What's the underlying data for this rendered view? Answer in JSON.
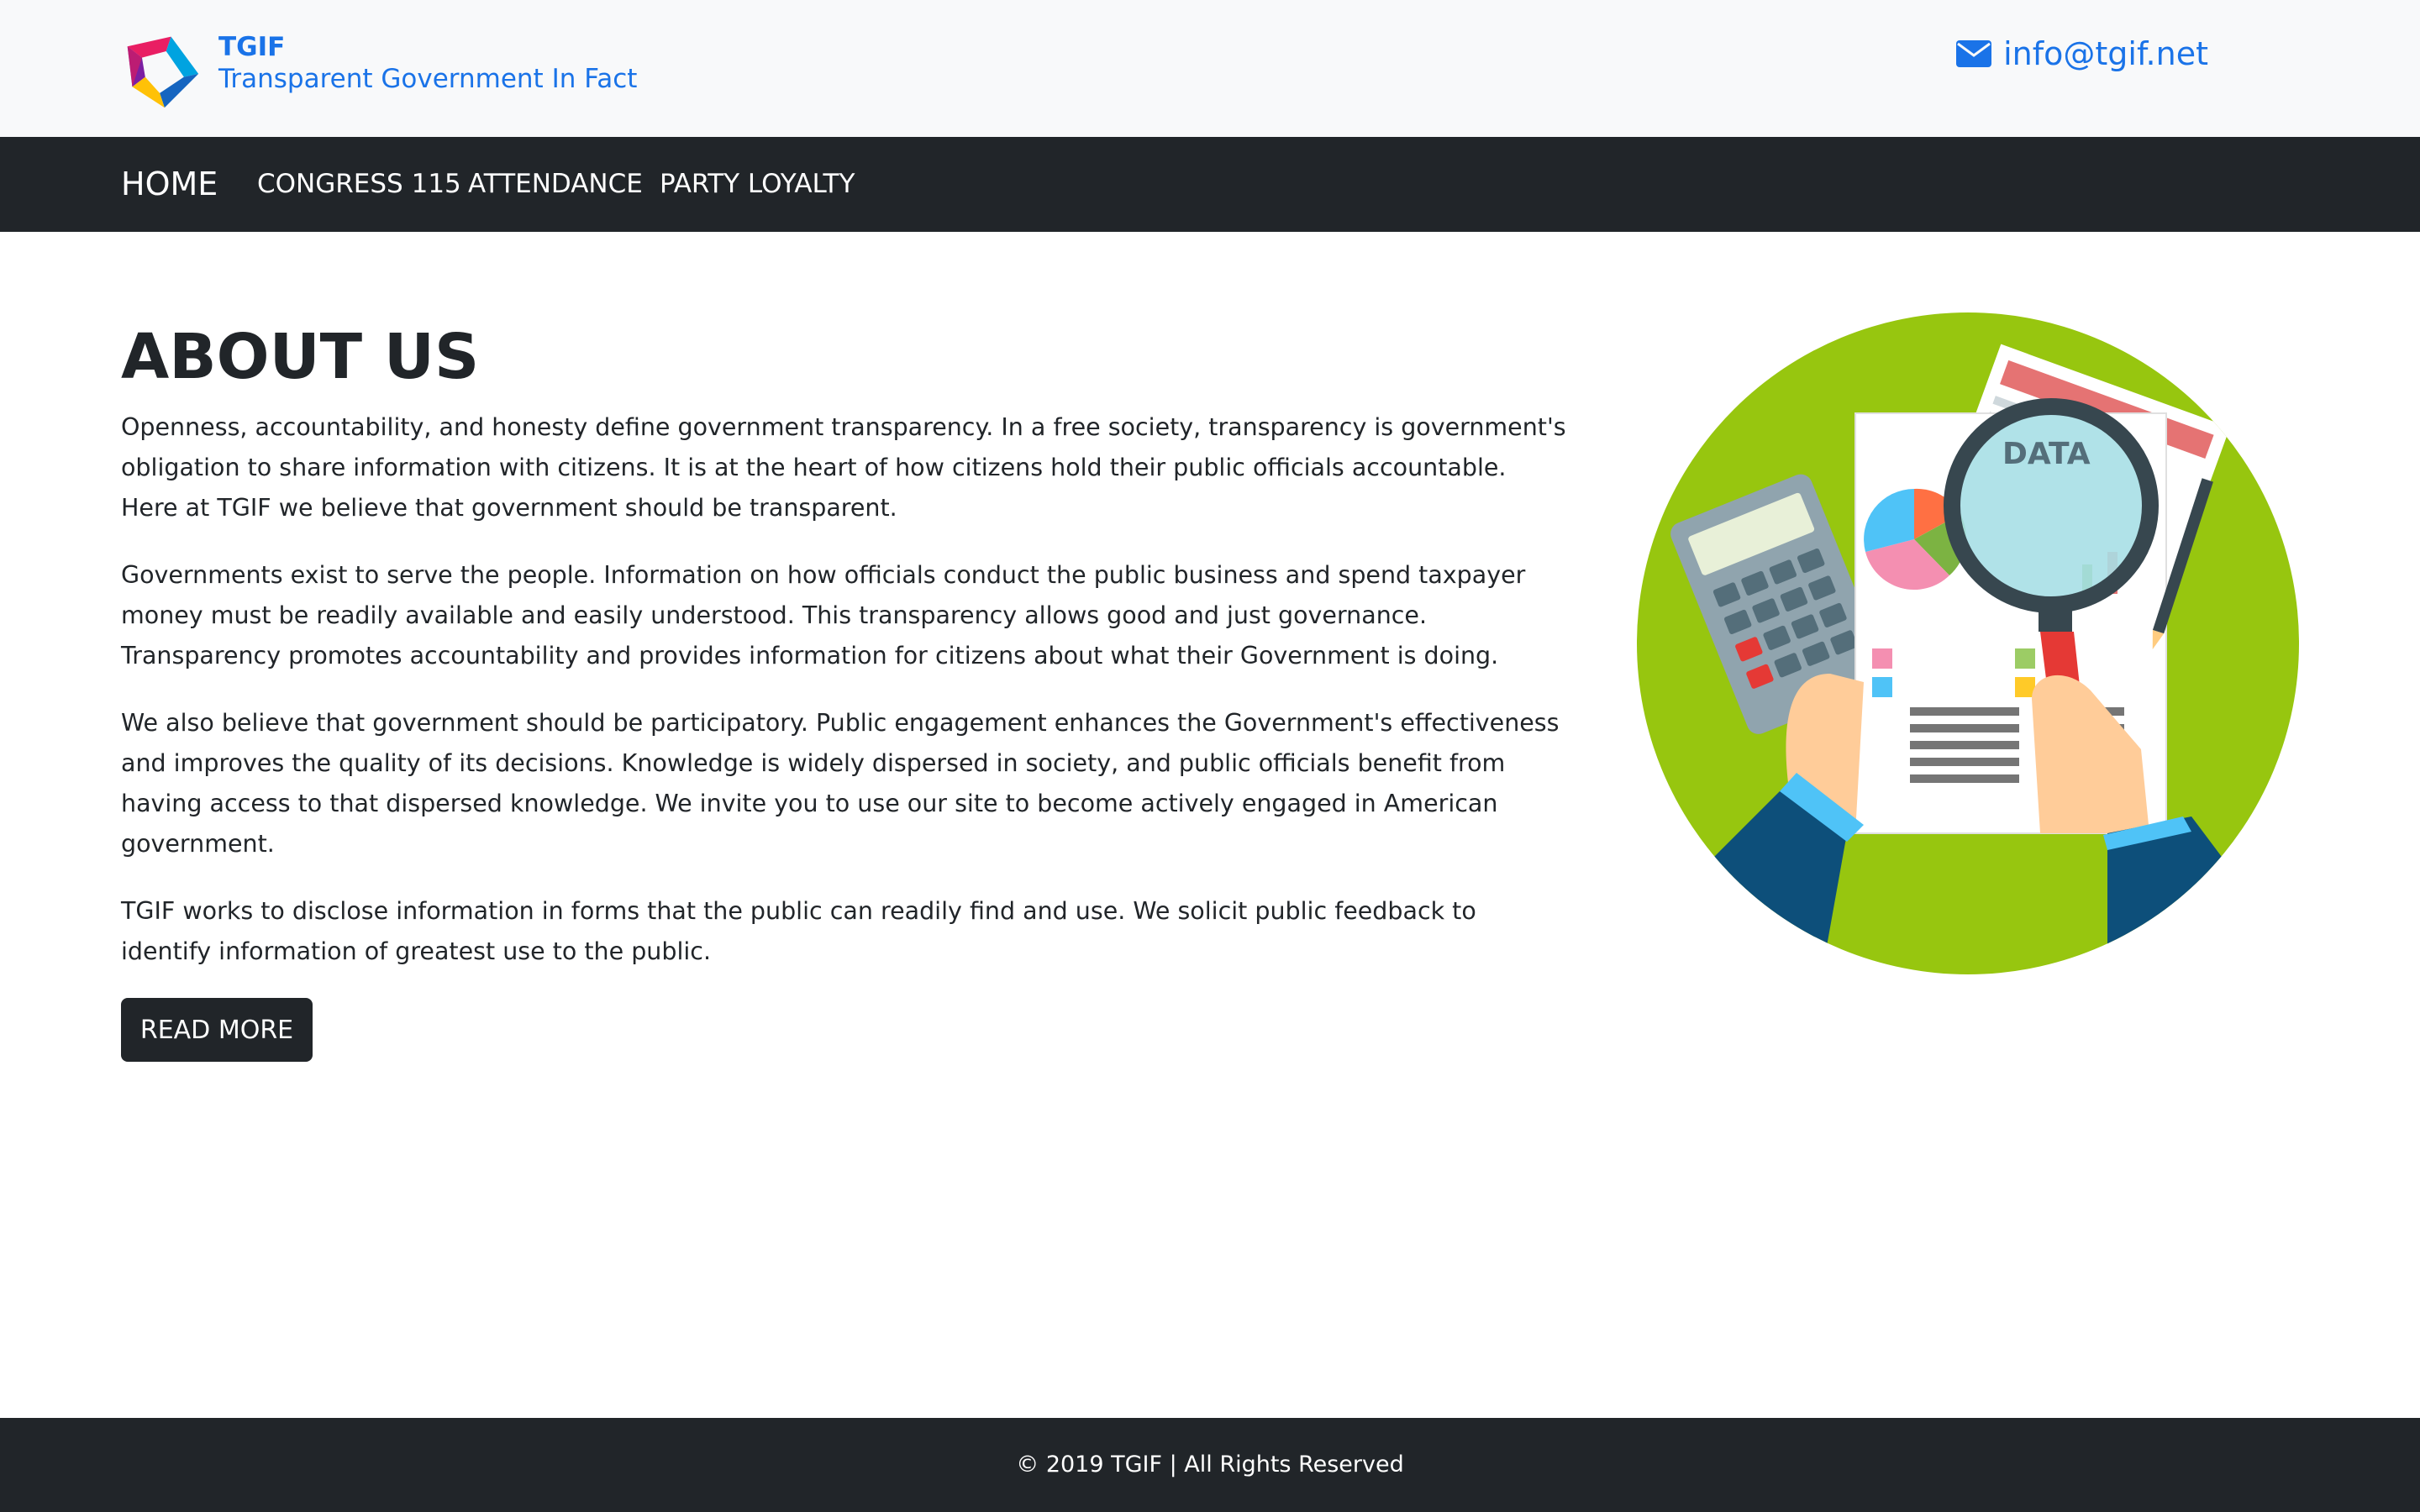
{
  "brand": {
    "name": "TGIF",
    "tagline": "Transparent Government In Fact",
    "logo_icon": "tgif-logo-icon",
    "color": "#1a73e8"
  },
  "contact": {
    "icon": "envelope-icon",
    "email": "info@tgif.net"
  },
  "nav": {
    "home": "HOME",
    "congress": "CONGRESS 115",
    "attendance": "ATTENDANCE",
    "party_loyalty": "PARTY LOYALTY"
  },
  "main": {
    "title": "ABOUT US",
    "paragraphs": [
      "Openness, accountability, and honesty define government transparency. In a free society, transparency is government's obligation to share information with citizens. It is at the heart of how citizens hold their public officials accountable. Here at TGIF we believe that government should be transparent.",
      "Governments exist to serve the people. Information on how officials conduct the public business and spend taxpayer money must be readily available and easily understood. This transparency allows good and just governance. Transparency promotes accountability and provides information for citizens about what their Government is doing.",
      "We also believe that government should be participatory. Public engagement enhances the Government's effectiveness and improves the quality of its decisions. Knowledge is widely dispersed in society, and public officials benefit from having access to that dispersed knowledge. We invite you to use our site to become actively engaged in American government.",
      "TGIF works to disclose information in forms that the public can readily find and use. We solicit public feedback to identify information of greatest use to the public."
    ],
    "read_more": "READ MORE"
  },
  "illustration": {
    "document_label": "DATA",
    "circle_color": "#97c60f"
  },
  "footer": {
    "copyright": "© 2019 TGIF | All Rights Reserved"
  },
  "colors": {
    "dark": "#212529",
    "light_bg": "#f8f9fa",
    "link_blue": "#1a73e8"
  }
}
